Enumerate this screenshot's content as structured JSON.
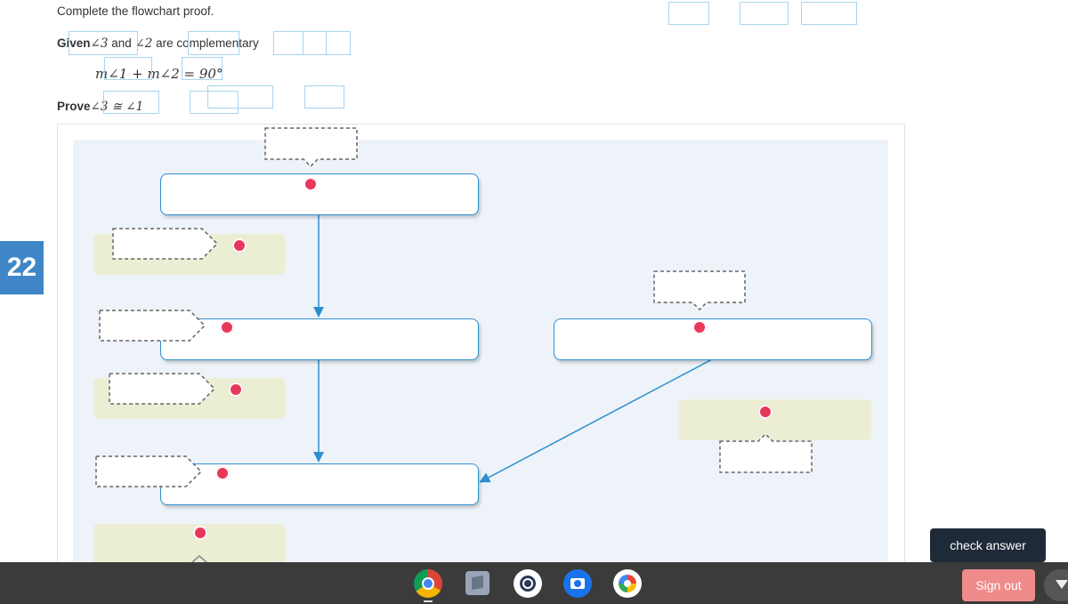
{
  "question": {
    "instruction": "Complete the flowchart proof.",
    "given_label": "Given",
    "given_angle3": "∠3",
    "given_and": "and",
    "given_angle2": "∠2",
    "given_rest": "are complementary",
    "given_equation": "m∠1 + m∠2 = 90°",
    "prove_label": "Prove",
    "prove_statement": "∠3 ≅ ∠1"
  },
  "sidebar": {
    "question_number": "22"
  },
  "tooltip": {
    "text": "check answer"
  },
  "taskbar": {
    "apps": [
      "chrome-icon",
      "files-icon",
      "app-icon",
      "camera-icon",
      "photos-icon"
    ],
    "sign_out": "Sign out"
  },
  "colors": {
    "statement_border": "#2b8fcf",
    "target": "#e8385a",
    "reason_bg": "#eceed3",
    "board_bg": "#eef3fa",
    "badge": "#3f86c7"
  }
}
